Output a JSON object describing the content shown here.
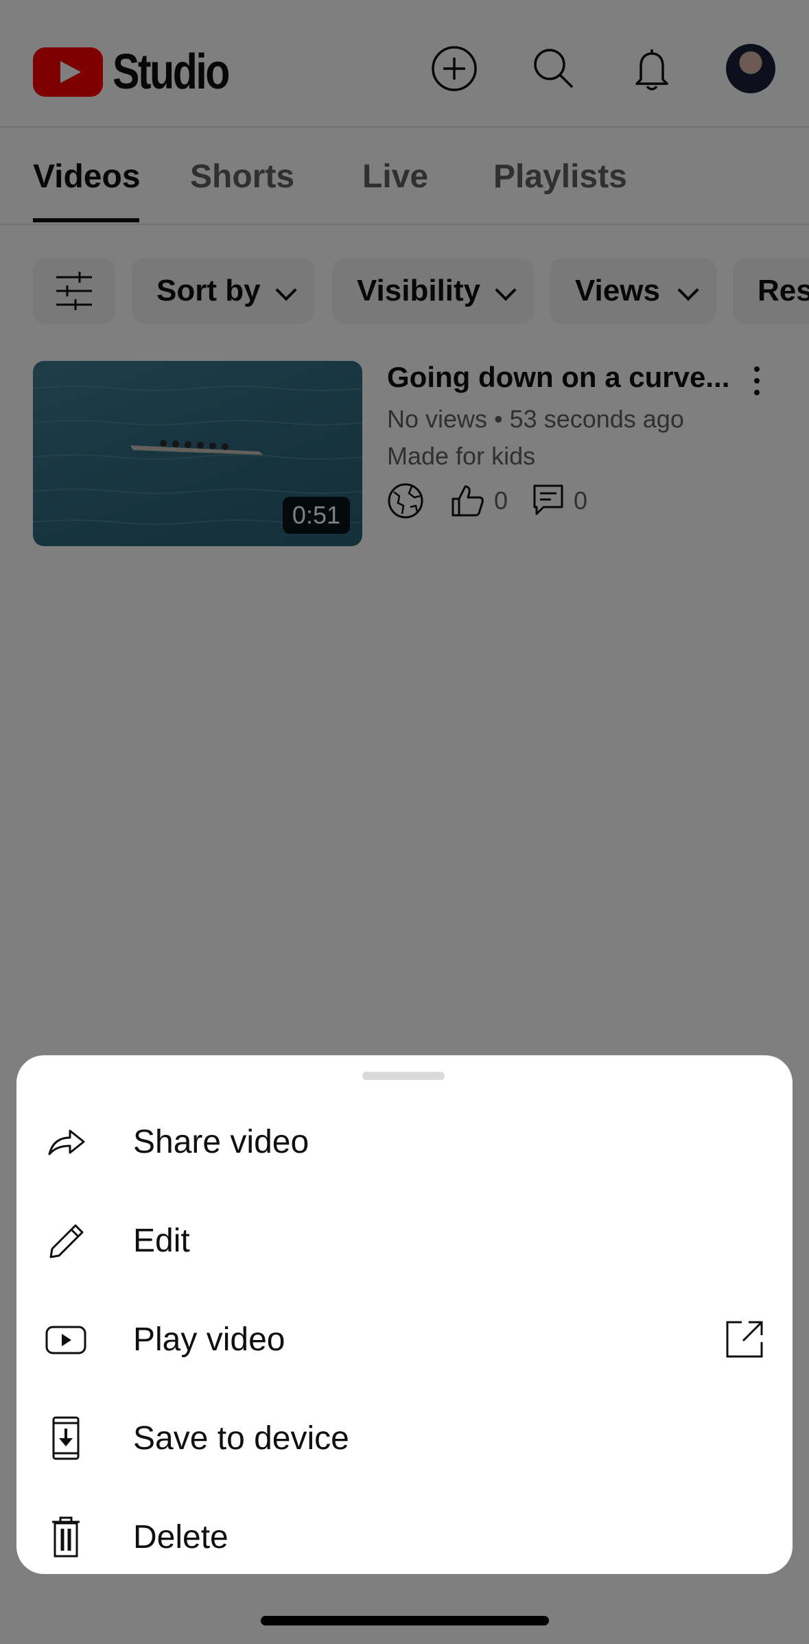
{
  "header": {
    "brand": "Studio",
    "icons": [
      "create-icon",
      "search-icon",
      "notifications-icon",
      "avatar"
    ]
  },
  "tabs": [
    {
      "label": "Videos",
      "active": true
    },
    {
      "label": "Shorts",
      "active": false
    },
    {
      "label": "Live",
      "active": false
    },
    {
      "label": "Playlists",
      "active": false
    }
  ],
  "filters": {
    "icon": "filter-sliders-icon",
    "chips": [
      "Sort by",
      "Visibility",
      "Views",
      "Res"
    ]
  },
  "video": {
    "title": "Going down on a curve...",
    "meta": "No views • 53 seconds ago",
    "audience": "Made for kids",
    "duration": "0:51",
    "likes": "0",
    "comments": "0"
  },
  "menu": {
    "items": [
      {
        "label": "Share video",
        "icon": "share-icon"
      },
      {
        "label": "Edit",
        "icon": "pencil-icon"
      },
      {
        "label": "Play video",
        "icon": "play-icon",
        "trailing_icon": "open-external-icon"
      },
      {
        "label": "Save to device",
        "icon": "download-to-device-icon"
      },
      {
        "label": "Delete",
        "icon": "trash-icon"
      }
    ]
  },
  "colors": {
    "brand": "#ff0000",
    "scrim": "rgba(0,0,0,0.5)"
  }
}
